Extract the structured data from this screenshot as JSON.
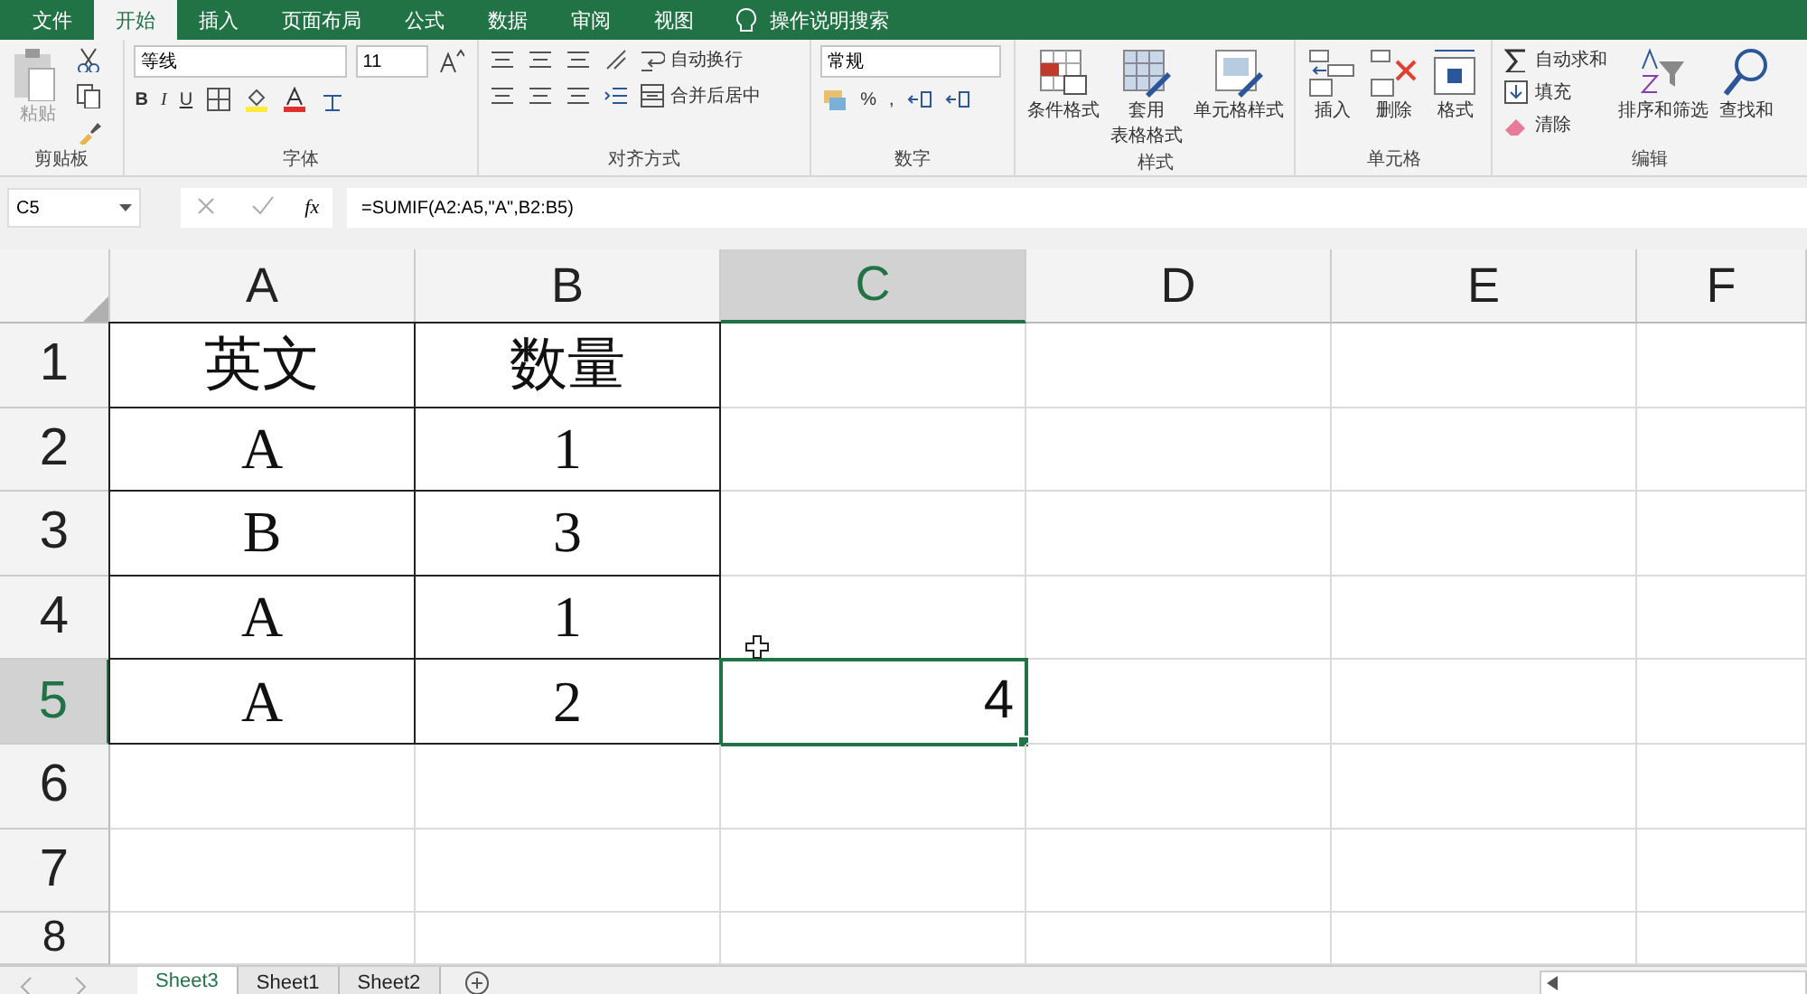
{
  "ribbon_tabs": [
    {
      "label": "文件",
      "selected": false
    },
    {
      "label": "开始",
      "selected": true
    },
    {
      "label": "插入",
      "selected": false
    },
    {
      "label": "页面布局",
      "selected": false
    },
    {
      "label": "公式",
      "selected": false
    },
    {
      "label": "数据",
      "selected": false
    },
    {
      "label": "审阅",
      "selected": false
    },
    {
      "label": "视图",
      "selected": false
    }
  ],
  "tell_me": "操作说明搜索",
  "groups": [
    {
      "kind": "clipboard",
      "label": "剪贴板",
      "paste": "粘贴"
    },
    {
      "kind": "font",
      "label": "字体",
      "font_name": "等线",
      "font_size": "11",
      "bold": "B",
      "italic": "I",
      "underline": "U"
    },
    {
      "kind": "alignment",
      "label": "对齐方式",
      "wrap": "自动换行",
      "merge": "合并后居中"
    },
    {
      "kind": "number",
      "label": "数字",
      "format": "常规",
      "percent": "%",
      "comma": ","
    },
    {
      "kind": "styles",
      "label": "样式",
      "buttons": [
        {
          "lines": [
            "条件格式"
          ]
        },
        {
          "lines": [
            "套用",
            "表格格式"
          ]
        },
        {
          "lines": [
            "单元格样式"
          ]
        }
      ]
    },
    {
      "kind": "cells",
      "label": "单元格",
      "buttons": [
        "插入",
        "删除",
        "格式"
      ]
    },
    {
      "kind": "editing",
      "label": "编辑",
      "autosum": "自动求和",
      "fill": "填充",
      "clear": "清除",
      "sort": "排序和筛选",
      "find": "查找和"
    }
  ],
  "name_box": "C5",
  "function_label": "fx",
  "formula": "=SUMIF(A2:A5,\"A\",B2:B5)",
  "columns": [
    {
      "label": "A",
      "selected": false
    },
    {
      "label": "B",
      "selected": false
    },
    {
      "label": "C",
      "selected": true
    },
    {
      "label": "D",
      "selected": false
    },
    {
      "label": "E",
      "selected": false
    },
    {
      "label": "F",
      "selected": false
    }
  ],
  "rows": [
    {
      "header": "1",
      "selected": false,
      "bordered": true,
      "cells": {
        "A": "英文",
        "B": "数量"
      }
    },
    {
      "header": "2",
      "selected": false,
      "bordered": true,
      "cells": {
        "A": "A",
        "B": "1"
      }
    },
    {
      "header": "3",
      "selected": false,
      "bordered": true,
      "cells": {
        "A": "B",
        "B": "3"
      }
    },
    {
      "header": "4",
      "selected": false,
      "bordered": true,
      "cells": {
        "A": "A",
        "B": "1"
      }
    },
    {
      "header": "5",
      "selected": true,
      "bordered": true,
      "cells": {
        "A": "A",
        "B": "2",
        "C": "4"
      }
    },
    {
      "header": "6",
      "selected": false,
      "bordered": false,
      "cells": {}
    },
    {
      "header": "7",
      "selected": false,
      "bordered": false,
      "cells": {}
    },
    {
      "header": "8",
      "selected": false,
      "bordered": false,
      "cells": {}
    }
  ],
  "sheet_tabs": [
    {
      "label": "Sheet3",
      "selected": true
    },
    {
      "label": "Sheet1",
      "selected": false
    },
    {
      "label": "Sheet2",
      "selected": false
    }
  ]
}
